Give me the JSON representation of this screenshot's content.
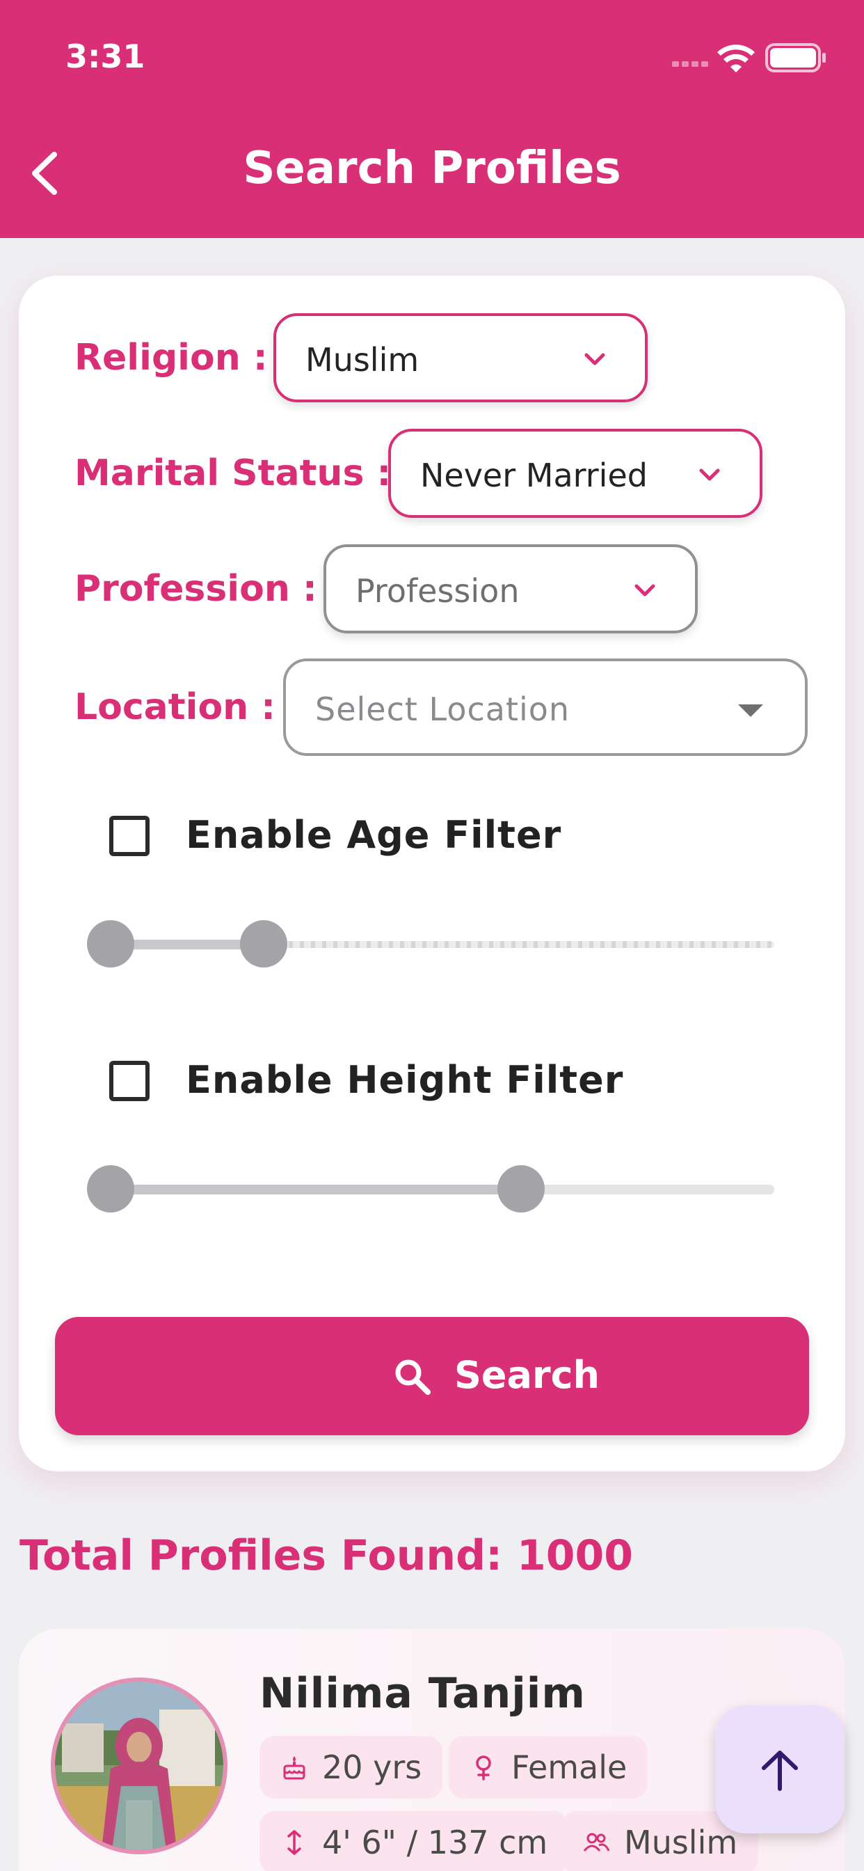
{
  "status_bar": {
    "time": "3:31"
  },
  "header": {
    "title": "Search Profiles"
  },
  "filters": {
    "religion": {
      "label": "Religion :",
      "value": "Muslim"
    },
    "marital_status": {
      "label": "Marital Status :",
      "value": "Never Married"
    },
    "profession": {
      "label": "Profession :",
      "value": "Profession"
    },
    "location": {
      "label": "Location :",
      "placeholder": "Select Location"
    },
    "age_filter": {
      "label": "Enable Age Filter",
      "checked": false,
      "range_fraction": [
        0,
        0.23
      ]
    },
    "height_filter": {
      "label": "Enable Height Filter",
      "checked": false,
      "range_fraction": [
        0,
        0.62
      ]
    }
  },
  "search_button": {
    "label": "Search"
  },
  "results": {
    "total_label": "Total Profiles Found: 1000",
    "profiles": [
      {
        "name": "Nilima Tanjim",
        "age": "20 yrs",
        "gender": "Female",
        "height": "4' 6\" / 137 cm",
        "religion": "Muslim"
      }
    ]
  },
  "colors": {
    "primary": "#d82f76",
    "fab_bg": "#ebe0fb",
    "fab_icon": "#2d1b6b"
  }
}
